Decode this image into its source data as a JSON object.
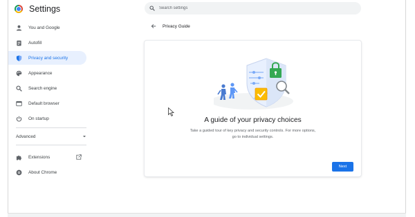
{
  "app": {
    "title": "Settings",
    "logo_icon": "chrome-logo-icon"
  },
  "search": {
    "placeholder": "Search settings",
    "icon": "search-icon"
  },
  "sidebar": {
    "items": [
      {
        "label": "You and Google",
        "icon": "person-icon",
        "active": false
      },
      {
        "label": "Autofill",
        "icon": "clipboard-icon",
        "active": false
      },
      {
        "label": "Privacy and security",
        "icon": "shield-icon",
        "active": true
      },
      {
        "label": "Appearance",
        "icon": "palette-icon",
        "active": false
      },
      {
        "label": "Search engine",
        "icon": "search-icon",
        "active": false
      },
      {
        "label": "Default browser",
        "icon": "browser-window-icon",
        "active": false
      },
      {
        "label": "On startup",
        "icon": "power-icon",
        "active": false
      }
    ],
    "advanced_label": "Advanced",
    "extensions_label": "Extensions",
    "about_label": "About Chrome"
  },
  "page": {
    "title": "Privacy Guide",
    "back_icon": "arrow-back-icon"
  },
  "card": {
    "heading": "A guide of your privacy choices",
    "description": "Take a guided tour of key privacy and security controls. For more options, go to individual settings.",
    "next_label": "Next"
  },
  "colors": {
    "accent": "#1a73e8",
    "active_bg": "#e8f0fe",
    "lock_green": "#34a853",
    "check_yellow": "#fbbc04",
    "figure_blue": "#4a7bd0"
  }
}
